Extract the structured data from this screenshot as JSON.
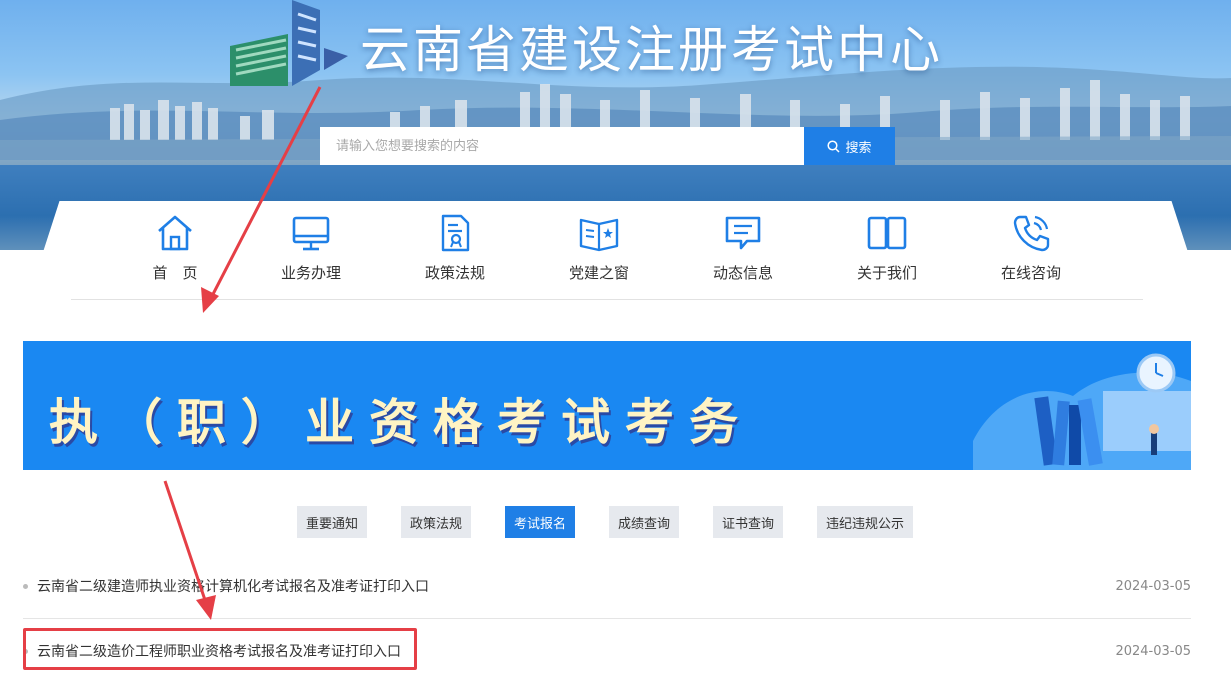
{
  "header": {
    "site_title": "云南省建设注册考试中心",
    "search_placeholder": "请输入您想要搜索的内容",
    "search_button": "搜索"
  },
  "nav": [
    {
      "label": "首　页",
      "icon": "home-icon"
    },
    {
      "label": "业务办理",
      "icon": "monitor-icon"
    },
    {
      "label": "政策法规",
      "icon": "document-icon"
    },
    {
      "label": "党建之窗",
      "icon": "open-book-icon"
    },
    {
      "label": "动态信息",
      "icon": "message-icon"
    },
    {
      "label": "关于我们",
      "icon": "book-icon"
    },
    {
      "label": "在线咨询",
      "icon": "phone-icon"
    }
  ],
  "banner": {
    "title": "执（职）业资格考试考务"
  },
  "tabs": [
    {
      "label": "重要通知"
    },
    {
      "label": "政策法规"
    },
    {
      "label": "考试报名"
    },
    {
      "label": "成绩查询"
    },
    {
      "label": "证书查询"
    },
    {
      "label": "违纪违规公示"
    }
  ],
  "active_tab": "考试报名",
  "articles": [
    {
      "title": "云南省二级建造师执业资格计算机化考试报名及准考证打印入口",
      "date": "2024-03-05"
    },
    {
      "title": "云南省二级造价工程师职业资格考试报名及准考证打印入口",
      "date": "2024-03-05"
    }
  ],
  "colors": {
    "accent": "#1f7fe6",
    "annotation": "#e53f46"
  }
}
